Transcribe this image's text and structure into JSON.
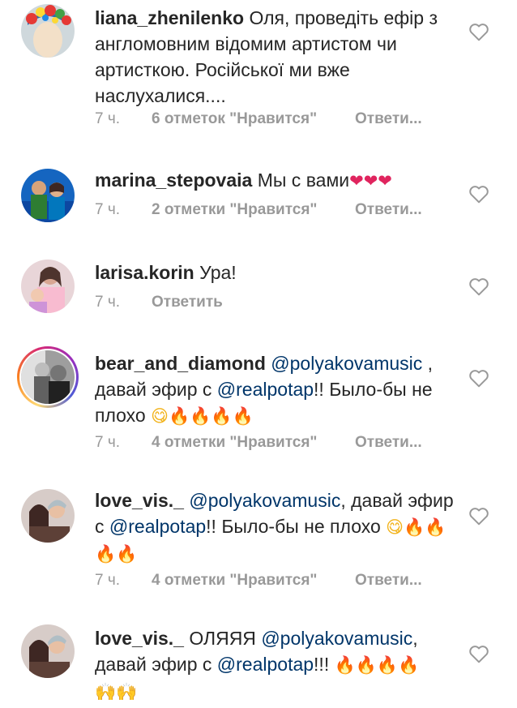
{
  "comments": [
    {
      "username": "liana_zhenilenko",
      "text": "Оля, проведіть ефір з англомовним відомим артистом чи артисткою. Російської ми вже наслухалися....",
      "time": "7 ч.",
      "likes": "6 отметок \"Нравится\"",
      "reply": "Ответи..."
    },
    {
      "username": "marina_stepovaia",
      "text": "Мы с вами",
      "emoji": "❤❤❤",
      "time": "7 ч.",
      "likes": "2 отметки \"Нравится\"",
      "reply": "Ответи..."
    },
    {
      "username": "larisa.korin",
      "text": "Ура!",
      "time": "7 ч.",
      "reply": "Ответить"
    },
    {
      "username": "bear_and_diamond",
      "mention1": "@polyakovamusic",
      "text_a": " , давай эфир с ",
      "mention2": "@realpotap",
      "text_b": "!! Было-бы не плохо ",
      "emoji_smile": "😋",
      "emoji_fire": "🔥🔥🔥🔥",
      "time": "7 ч.",
      "likes": "4 отметки \"Нравится\"",
      "reply": "Ответи..."
    },
    {
      "username": "love_vis._",
      "mention1": "@polyakovamusic",
      "text_a": ", давай эфир с ",
      "mention2": "@realpotap",
      "text_b": "!! Было-бы не плохо ",
      "emoji_smile": "😋",
      "emoji_fire": "🔥🔥🔥🔥",
      "time": "7 ч.",
      "likes": "4 отметки \"Нравится\"",
      "reply": "Ответи..."
    },
    {
      "username": "love_vis._",
      "text_pre": "ОЛЯЯЯ ",
      "mention1": "@polyakovamusic",
      "text_a": ", давай эфир с ",
      "mention2": "@realpotap",
      "text_b": "!!! ",
      "emoji_fire": "🔥🔥🔥🔥",
      "emoji_hands": "🙌🙌"
    }
  ],
  "icons": {
    "like": "heart-outline-icon"
  },
  "colors": {
    "text": "#262626",
    "secondary": "#999999",
    "mention": "#003569"
  }
}
